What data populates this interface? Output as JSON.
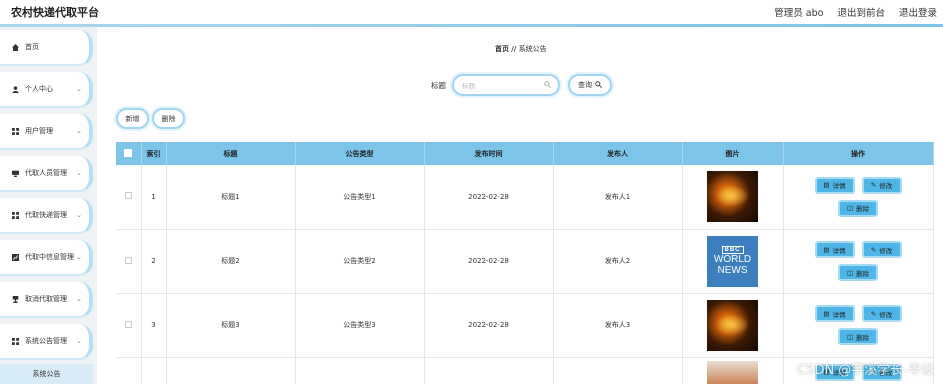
{
  "app": {
    "title": "农村快递代取平台",
    "header_links": [
      "管理员 abo",
      "退出到前台",
      "退出登录"
    ]
  },
  "sidebar": {
    "items": [
      {
        "label": "首页",
        "icon": "home-icon",
        "has_chevron": false
      },
      {
        "label": "个人中心",
        "icon": "user-icon",
        "has_chevron": true
      },
      {
        "label": "用户管理",
        "icon": "grid-icon",
        "has_chevron": true
      },
      {
        "label": "代取人员管理",
        "icon": "monitor-icon",
        "has_chevron": true
      },
      {
        "label": "代取快递管理",
        "icon": "grid-icon",
        "has_chevron": true
      },
      {
        "label": "代取中信息管理",
        "icon": "chart-icon",
        "has_chevron": true
      },
      {
        "label": "取消代取管理",
        "icon": "trophy-icon",
        "has_chevron": true
      },
      {
        "label": "系统公告管理",
        "icon": "grid-icon",
        "has_chevron": true
      }
    ],
    "sub_item": "系统公告"
  },
  "breadcrumb": {
    "home": "首页",
    "sep": "//",
    "current": "系统公告"
  },
  "search": {
    "label": "标题",
    "placeholder": "标题",
    "button": "查询"
  },
  "actions": {
    "add": "新增",
    "delete": "删除"
  },
  "table": {
    "columns": [
      "",
      "索引",
      "标题",
      "公告类型",
      "发布时间",
      "发布人",
      "图片",
      "操作"
    ],
    "rows": [
      {
        "index": "1",
        "title": "标题1",
        "type": "公告类型1",
        "time": "2022-02-28",
        "publisher": "发布人1",
        "image": "fire-image"
      },
      {
        "index": "2",
        "title": "标题2",
        "type": "公告类型2",
        "time": "2022-02-28",
        "publisher": "发布人2",
        "image": "bbc-news-image"
      },
      {
        "index": "3",
        "title": "标题3",
        "type": "公告类型3",
        "time": "2022-02-28",
        "publisher": "发布人3",
        "image": "fire-image"
      }
    ],
    "news_image_text": {
      "brand": "BBC",
      "line1": "WORLD",
      "line2": "NEWS"
    },
    "ops": {
      "detail": "详情",
      "edit": "修改",
      "delete": "删除"
    }
  },
  "watermark": "CSDN @宇溪学长-毕设",
  "colors": {
    "accent": "#7cc4e8",
    "button": "#4db6e6",
    "border": "#9fd5ee"
  }
}
